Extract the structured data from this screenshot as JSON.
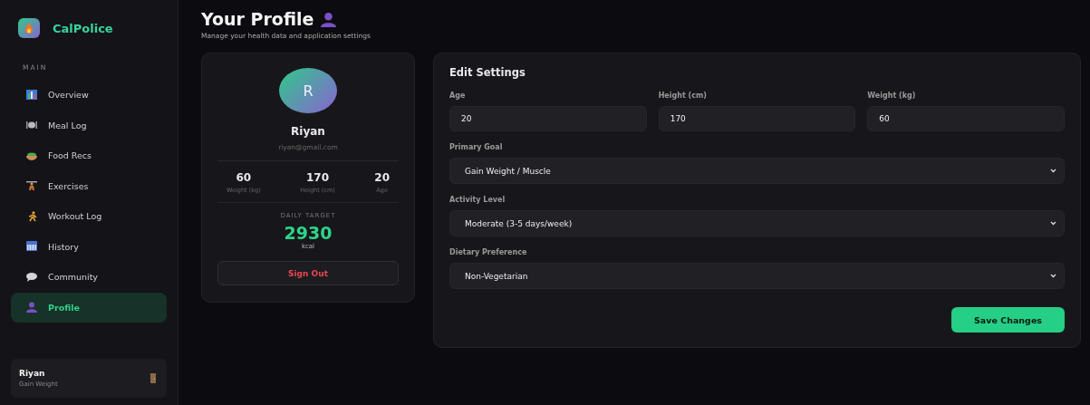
{
  "sidebar": {
    "brand": "CalPolice",
    "section_label": "MAIN",
    "items": [
      {
        "label": "Overview",
        "selected": false
      },
      {
        "label": "Meal Log",
        "selected": false
      },
      {
        "label": "Food Recs",
        "selected": false
      },
      {
        "label": "Exercises",
        "selected": false
      },
      {
        "label": "Workout Log",
        "selected": false
      },
      {
        "label": "History",
        "selected": false
      },
      {
        "label": "Community",
        "selected": false
      },
      {
        "label": "Profile",
        "selected": true
      }
    ],
    "user": {
      "name": "Riyan",
      "goal": "Gain Weight"
    }
  },
  "header": {
    "title": "Your Profile",
    "subtitle": "Manage your health data and application settings"
  },
  "profile_card": {
    "avatar_letter": "R",
    "name": "Riyan",
    "email": "riyan@gmail.com",
    "stats": [
      {
        "value": "60",
        "label": "Weight (kg)"
      },
      {
        "value": "170",
        "label": "Height (cm)"
      },
      {
        "value": "20",
        "label": "Age"
      }
    ],
    "target_label": "DAILY TARGET",
    "target_value": "2930",
    "target_unit": "kcal",
    "sign_out": "Sign Out"
  },
  "settings": {
    "title": "Edit Settings",
    "inputs": [
      {
        "label": "Age",
        "value": "20"
      },
      {
        "label": "Height (cm)",
        "value": "170"
      },
      {
        "label": "Weight (kg)",
        "value": "60"
      }
    ],
    "selects": [
      {
        "label": "Primary Goal",
        "value": "Gain Weight / Muscle"
      },
      {
        "label": "Activity Level",
        "value": "Moderate (3-5 days/week)"
      },
      {
        "label": "Dietary Preference",
        "value": "Non-Vegetarian"
      }
    ],
    "save": "Save Changes"
  }
}
